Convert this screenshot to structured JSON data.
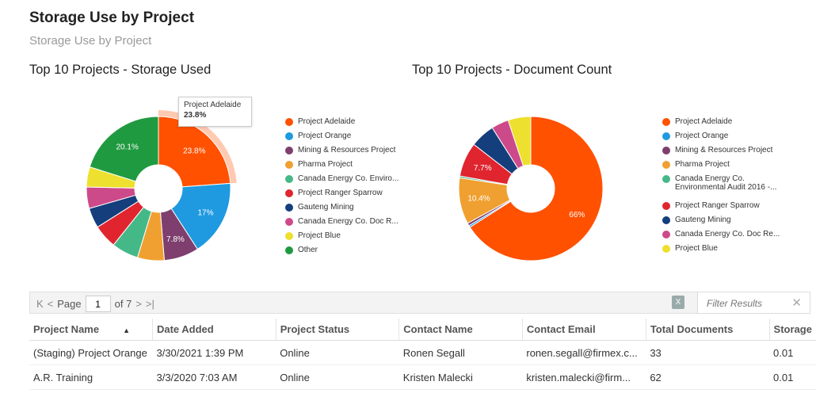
{
  "page": {
    "title": "Storage Use by Project",
    "subtitle": "Storage Use by Project"
  },
  "chart_data": [
    {
      "type": "pie",
      "title": "Top 10 Projects - Storage Used",
      "labels": [
        "Project Adelaide",
        "Project Orange",
        "Mining & Resources Project",
        "Pharma Project",
        "Canada Energy Co. Enviro...",
        "Project Ranger Sparrow",
        "Gauteng Mining",
        "Canada Energy Co. Doc R...",
        "Project Blue",
        "Other"
      ],
      "values": [
        23.8,
        17,
        7.8,
        6.0,
        6.0,
        5.3,
        4.5,
        4.8,
        4.5,
        20.1
      ],
      "data_labels": [
        "23.8%",
        "17%",
        "7.8%",
        "",
        "",
        "",
        "",
        "",
        "",
        "20.1%"
      ],
      "colors": [
        "#ff5100",
        "#1f9ae0",
        "#7e3f6e",
        "#f0a030",
        "#45b888",
        "#e0252f",
        "#143e7c",
        "#cd4a8a",
        "#ede02e",
        "#209a40"
      ],
      "tooltip": {
        "label": "Project Adelaide",
        "value": "23.8%"
      },
      "legend": "right"
    },
    {
      "type": "pie",
      "title": "Top 10 Projects - Document Count",
      "labels": [
        "Project Adelaide",
        "Project Orange",
        "Mining & Resources Project",
        "Pharma Project",
        "Canada Energy Co. Environmental Audit 2016 -...",
        "Project Ranger Sparrow",
        "Gauteng Mining",
        "Canada Energy Co. Doc Re...",
        "Project Blue"
      ],
      "values": [
        66,
        0.4,
        0.6,
        10.4,
        0.4,
        7.7,
        5.5,
        3.9,
        5.1
      ],
      "data_labels": [
        "66%",
        "",
        "",
        "10.4%",
        "",
        "7.7%",
        "",
        "",
        ""
      ],
      "colors": [
        "#ff5100",
        "#1f9ae0",
        "#7e3f6e",
        "#f0a030",
        "#45b888",
        "#e0252f",
        "#143e7c",
        "#cd4a8a",
        "#ede02e"
      ],
      "legend": "right"
    }
  ],
  "grid": {
    "page_label": "Page",
    "page_value": "1",
    "page_of": "of 7",
    "filter_placeholder": "Filter Results",
    "columns": [
      "Project Name",
      "Date Added",
      "Project Status",
      "Contact Name",
      "Contact Email",
      "Total Documents",
      "Storage"
    ],
    "rows": [
      [
        "(Staging) Project Orange",
        "3/30/2021 1:39 PM",
        "Online",
        "Ronen Segall",
        "ronen.segall@firmex.c...",
        "33",
        "0.01"
      ],
      [
        "A.R. Training",
        "3/3/2020 7:03 AM",
        "Online",
        "Kristen Malecki",
        "kristen.malecki@firm...",
        "62",
        "0.01"
      ]
    ]
  }
}
